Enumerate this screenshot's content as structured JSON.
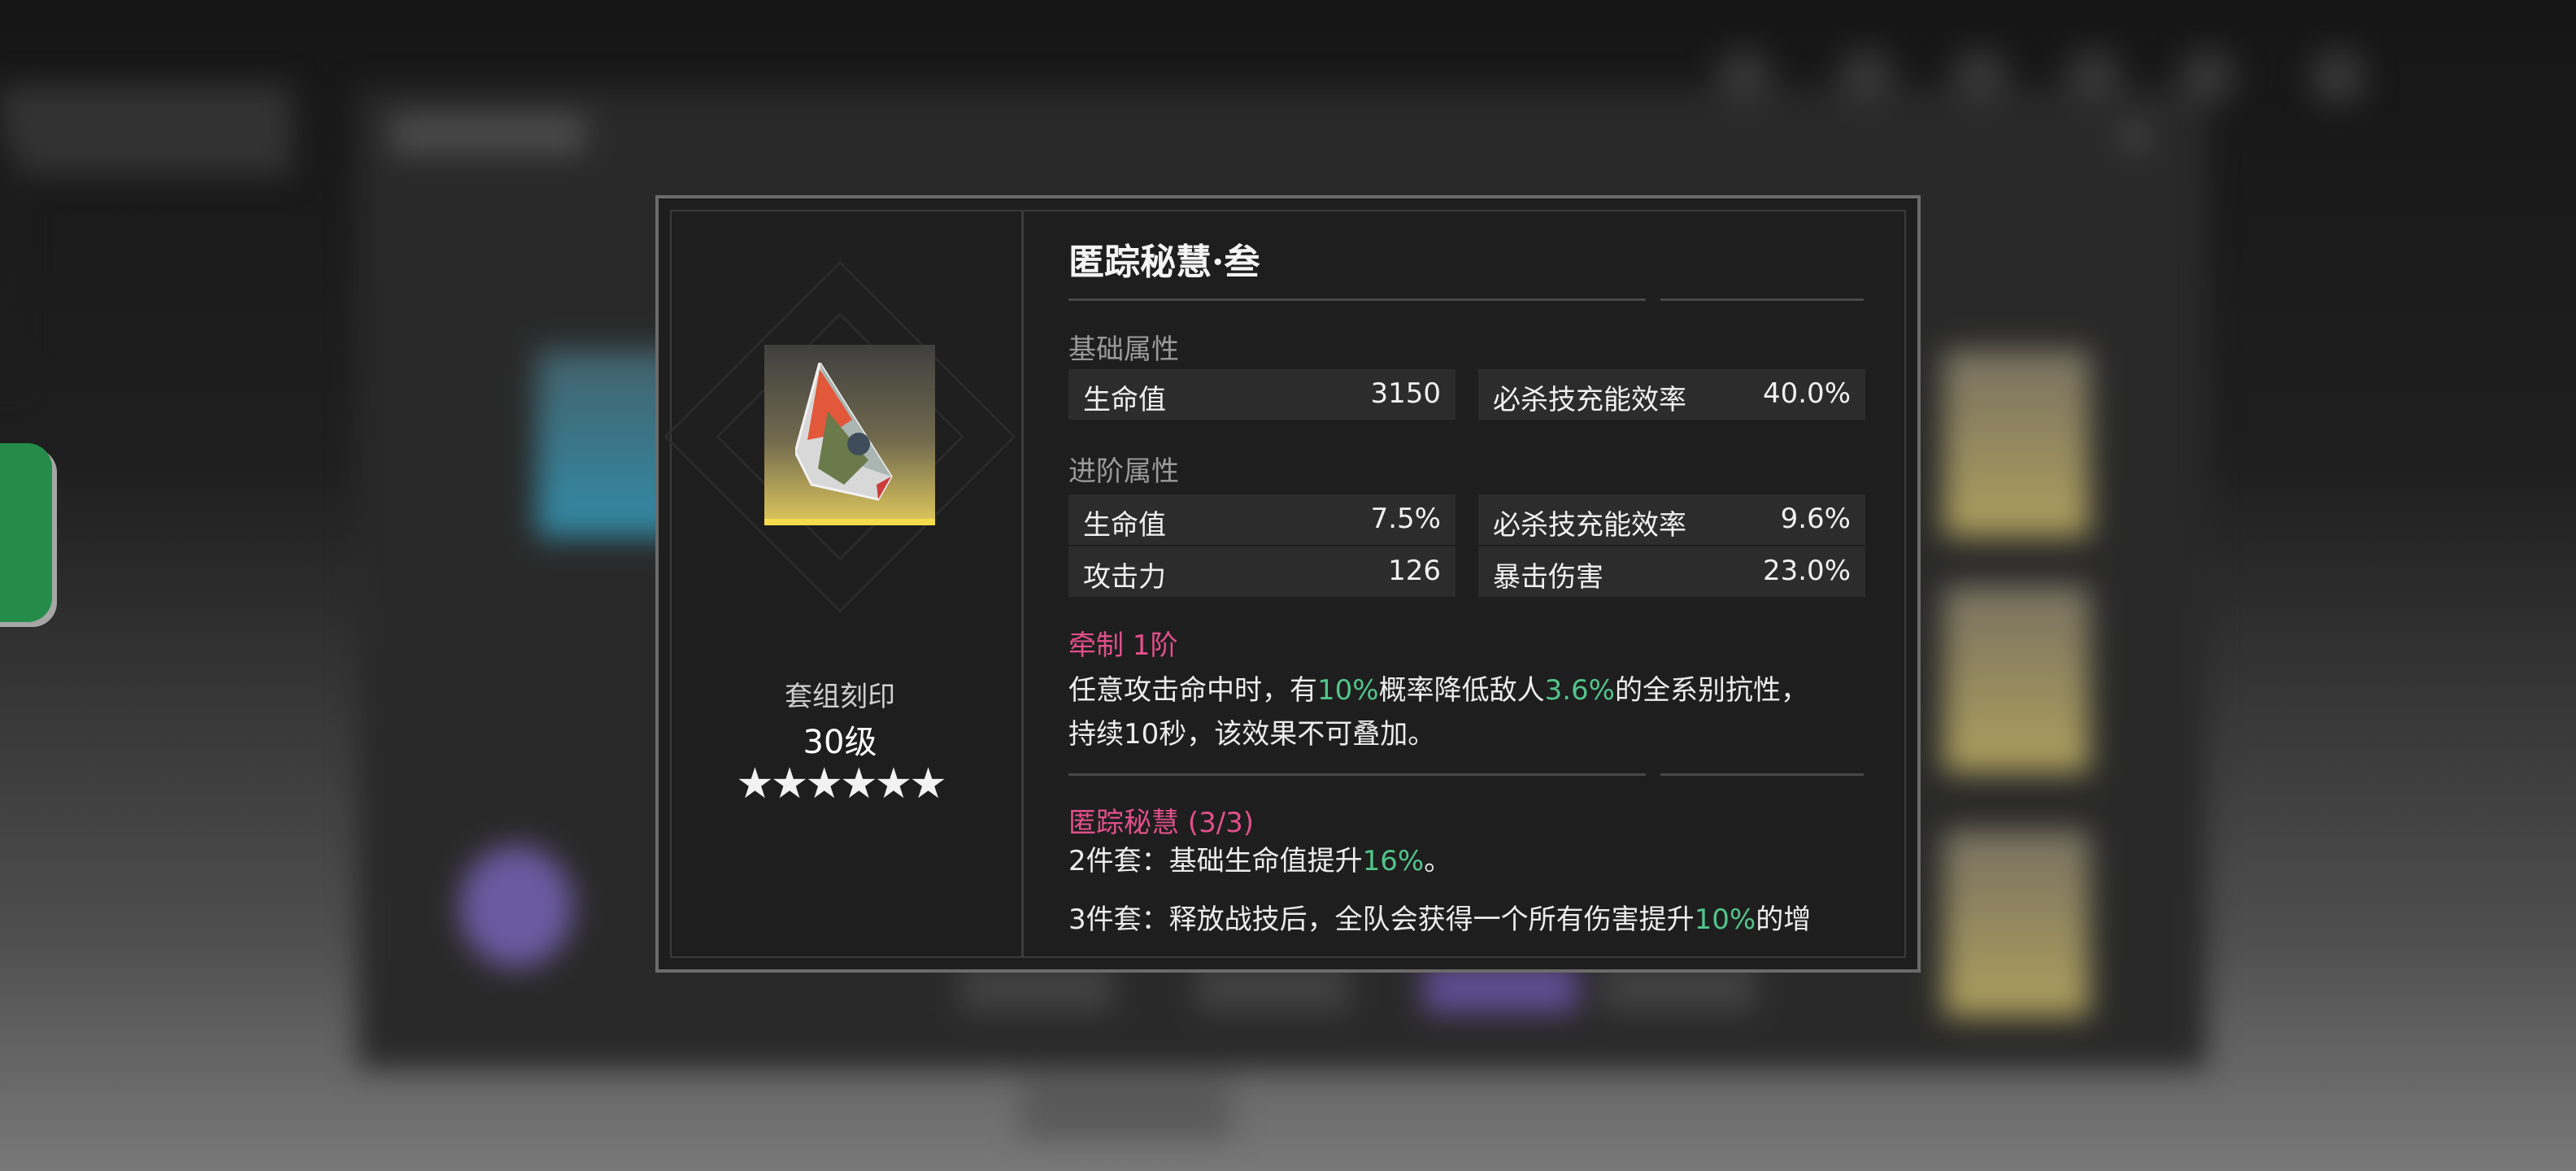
{
  "dialog": {
    "item_title": "匿踪秘慧·叁",
    "set_label": "套组刻印",
    "level": "30级",
    "stars": "★★★★★★",
    "star_count": 6,
    "base_section": {
      "label": "基础属性",
      "stats": [
        {
          "name": "生命值",
          "value": "3150"
        },
        {
          "name": "必杀技充能效率",
          "value": "40.0%"
        }
      ]
    },
    "advanced_section": {
      "label": "进阶属性",
      "stats": [
        {
          "name": "生命值",
          "value": "7.5%"
        },
        {
          "name": "必杀技充能效率",
          "value": "9.6%"
        },
        {
          "name": "攻击力",
          "value": "126"
        },
        {
          "name": "暴击伤害",
          "value": "23.0%"
        }
      ]
    },
    "restraint": {
      "title": "牵制 1阶",
      "line1_a": "任意攻击命中时，有",
      "line1_v1": "10%",
      "line1_b": "概率降低敌人",
      "line1_v2": "3.6%",
      "line1_c": "的全系别抗性，",
      "line2": "持续10秒，该效果不可叠加。"
    },
    "set_effect": {
      "title": "匿踪秘慧 (3/3)",
      "two_piece_a": "2件套：基础生命值提升",
      "two_piece_v": "16%",
      "two_piece_b": "。",
      "three_piece_a": "3件套：释放战技后，全队会获得一个所有伤害提升",
      "three_piece_v": "10%",
      "three_piece_b": "的增"
    }
  },
  "colors": {
    "accent_pink": "#e0508a",
    "accent_green": "#53c48a",
    "icon_gold": "#f5dc4c"
  }
}
